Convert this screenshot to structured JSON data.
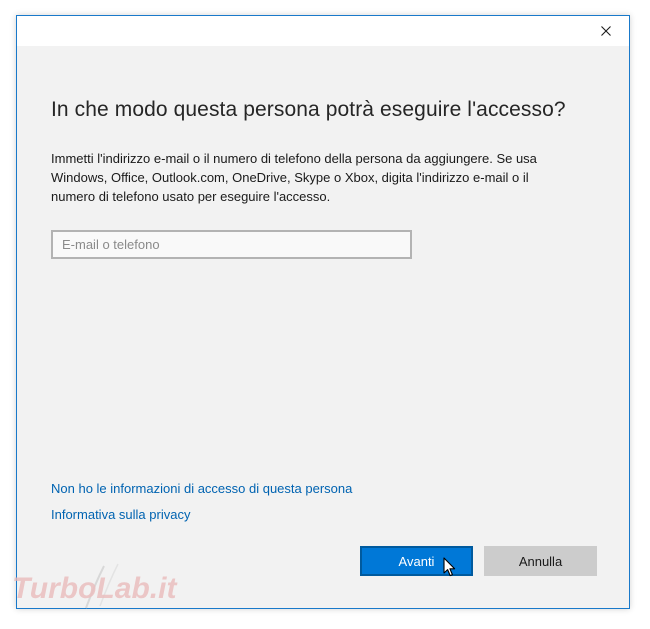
{
  "dialog": {
    "close_icon": "close-icon",
    "heading": "In che modo questa persona potrà eseguire l'accesso?",
    "description": "Immetti l'indirizzo e-mail o il numero di telefono della persona da aggiungere. Se usa Windows, Office, Outlook.com, OneDrive, Skype o Xbox, digita l'indirizzo e-mail o il numero di telefono usato per eseguire l'accesso.",
    "email_input": {
      "value": "",
      "placeholder": "E-mail o telefono"
    },
    "links": {
      "no_info": "Non ho le informazioni di accesso di questa persona",
      "privacy": "Informativa sulla privacy"
    },
    "buttons": {
      "next": "Avanti",
      "cancel": "Annulla"
    }
  },
  "watermark": {
    "text": "TurboLab.it"
  },
  "colors": {
    "accent": "#0078d7",
    "link": "#0063b1",
    "window_border": "#1979ca",
    "background": "#f2f2f2"
  }
}
